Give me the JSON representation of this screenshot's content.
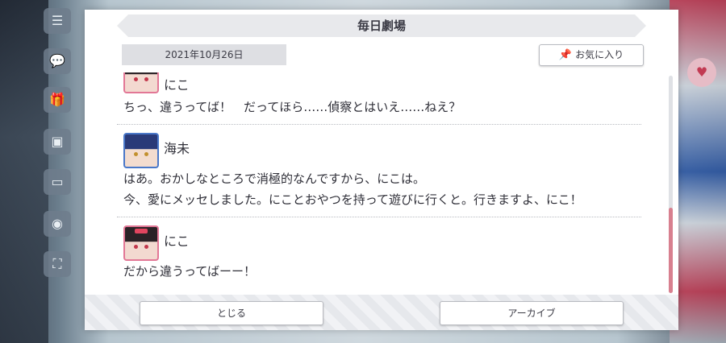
{
  "dialog": {
    "title": "毎日劇場",
    "date": "2021年10月26日",
    "favorite_label": "お気に入り"
  },
  "entries": [
    {
      "speaker": "にこ",
      "avatar": "nico-avatar",
      "lines": [
        "ちっ、違うってば！　だってほら……偵察とはいえ……ねえ？"
      ]
    },
    {
      "speaker": "海未",
      "avatar": "umi-avatar",
      "lines": [
        "はあ。おかしなところで消極的なんですから、にこは。",
        "今、愛にメッセしました。にことおやつを持って遊びに行くと。行きますよ、にこ！"
      ]
    },
    {
      "speaker": "にこ",
      "avatar": "nico-avatar",
      "lines": [
        "だから違うってばーー！"
      ]
    }
  ],
  "footer": {
    "close_label": "とじる",
    "archive_label": "アーカイブ"
  },
  "scroll": {
    "position_fraction": 0.61
  },
  "colors": {
    "accent": "#d8808f",
    "nico_frame": "#e27796",
    "umi_frame": "#4a78c9"
  }
}
